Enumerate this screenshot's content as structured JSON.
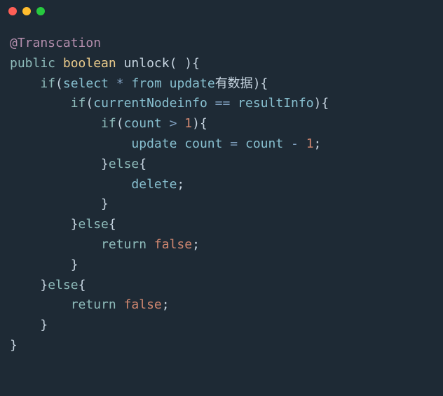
{
  "code": {
    "annotation": "@Transcation",
    "kw_public": "public",
    "kw_boolean": "boolean",
    "method_name": "unlock",
    "parens_empty": "( )",
    "brace_open": "{",
    "brace_close": "}",
    "kw_if": "if",
    "kw_else": "else",
    "paren_open": "(",
    "paren_close": ")",
    "select": "select",
    "star": "*",
    "from": "from",
    "update": "update",
    "chinese_text": "有数据",
    "currentNodeinfo": "currentNodeinfo",
    "op_eq": "==",
    "resultInfo": "resultInfo",
    "count": "count",
    "op_gt": ">",
    "num_1": "1",
    "op_assign": "=",
    "op_minus": "-",
    "semicolon": ";",
    "delete": "delete",
    "kw_return": "return",
    "kw_false": "false"
  }
}
